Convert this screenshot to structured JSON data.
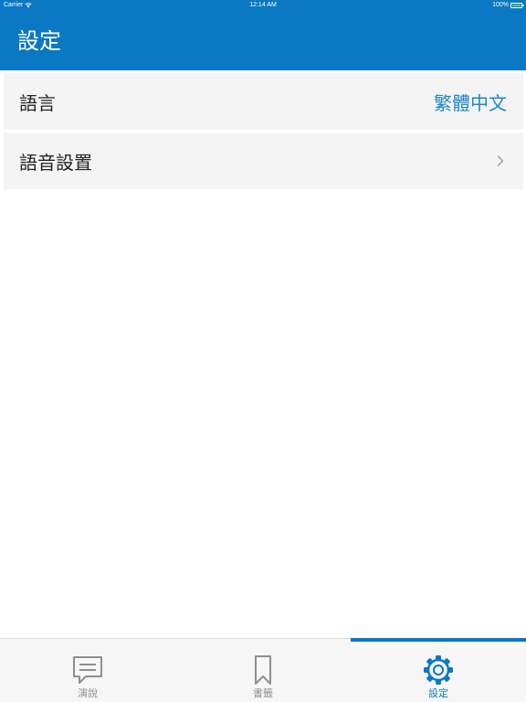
{
  "status_bar": {
    "carrier": "Carrier",
    "time": "12:14 AM",
    "battery": "100%"
  },
  "header": {
    "title": "設定"
  },
  "settings": {
    "language": {
      "label": "語言",
      "value": "繁體中文"
    },
    "voice": {
      "label": "語音設置"
    }
  },
  "tabs": [
    {
      "label": "演說",
      "icon": "speech-bubble-icon",
      "active": false
    },
    {
      "label": "書籤",
      "icon": "bookmark-icon",
      "active": false
    },
    {
      "label": "設定",
      "icon": "gear-icon",
      "active": true
    }
  ],
  "colors": {
    "accent": "#0a78c2",
    "value_text": "#1d86c8",
    "inactive_tab": "#8e8e93",
    "row_background": "#f4f4f4"
  }
}
